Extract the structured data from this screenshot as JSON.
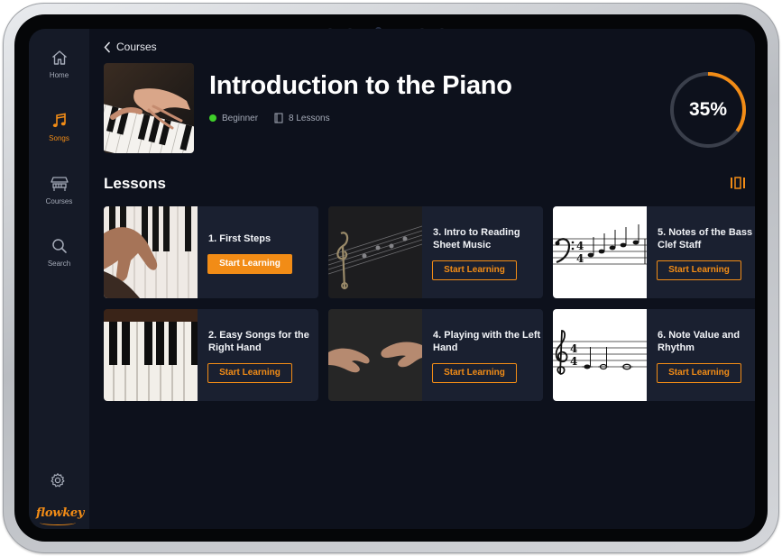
{
  "nav": [
    {
      "label": "Home",
      "icon": "home-icon",
      "active": false
    },
    {
      "label": "Songs",
      "icon": "music-note-icon",
      "active": true
    },
    {
      "label": "Courses",
      "icon": "courses-icon",
      "active": false
    },
    {
      "label": "Search",
      "icon": "search-icon",
      "active": false
    }
  ],
  "brand": {
    "logo": "flowkey",
    "accent": "#f28c16"
  },
  "header": {
    "back_label": "Courses",
    "title": "Introduction to the Piano",
    "level": "Beginner",
    "lessons_count": "8 Lessons",
    "progress_label": "35%",
    "progress_value": 0.35
  },
  "section": {
    "title": "Lessons"
  },
  "lessons": [
    {
      "title": "1. First Steps",
      "button": "Start Learning",
      "primary": true
    },
    {
      "title": "2. Easy Songs for the Right Hand",
      "button": "Start Learning",
      "primary": false
    },
    {
      "title": "3. Intro to Reading Sheet Music",
      "button": "Start Learning",
      "primary": false
    },
    {
      "title": "4. Playing with the Left Hand",
      "button": "Start Learning",
      "primary": false
    },
    {
      "title": "5. Notes of the Bass Clef Staff",
      "button": "Start Learning",
      "primary": false
    },
    {
      "title": "6. Note Value and Rhythm",
      "button": "Start Learning",
      "primary": false
    }
  ]
}
